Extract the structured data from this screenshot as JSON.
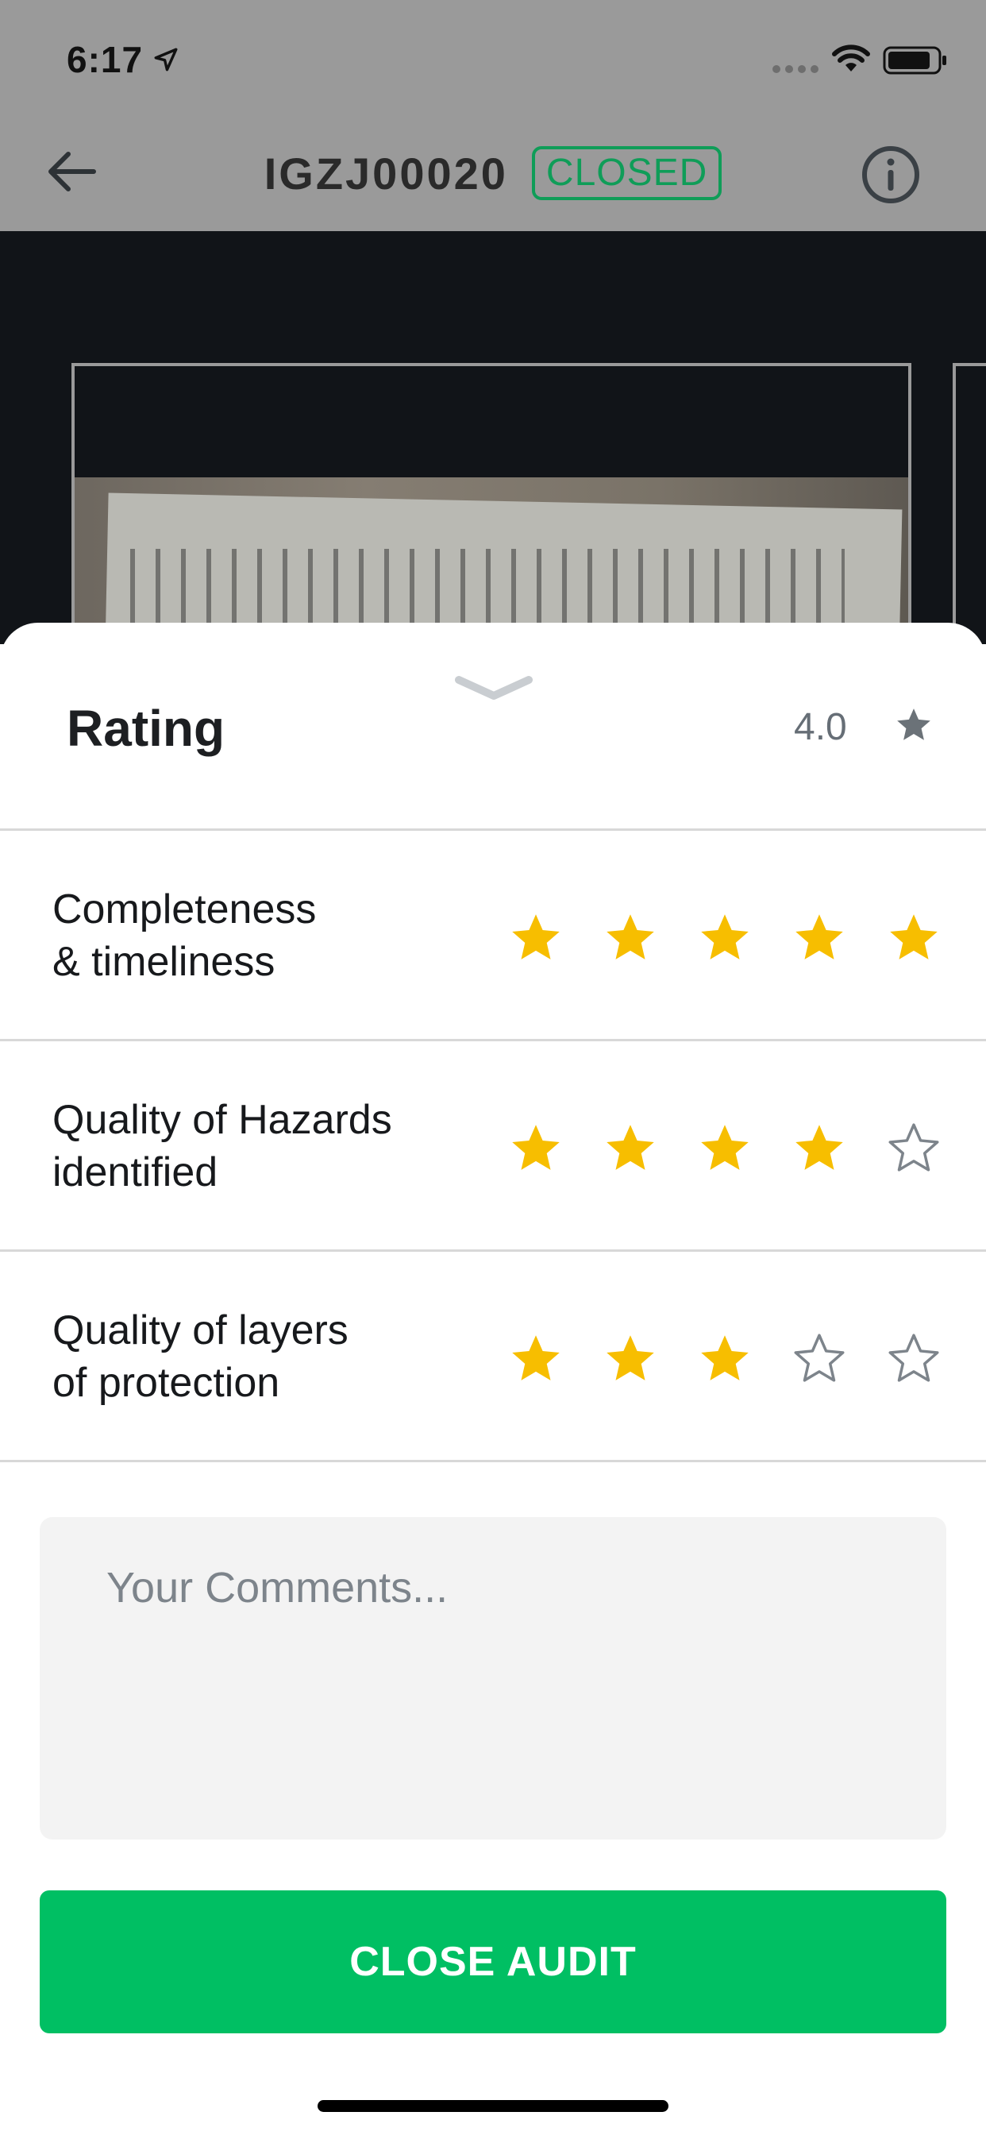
{
  "status_bar": {
    "time": "6:17",
    "icons": [
      "location-arrow-icon",
      "signal-icon",
      "wifi-icon",
      "battery-icon"
    ]
  },
  "header": {
    "back_icon": "arrow-left-icon",
    "title": "IGZJ00020",
    "status_badge": "CLOSED",
    "info_icon": "info-circle-icon"
  },
  "rating": {
    "title": "Rating",
    "value": "4.0",
    "icon": "star-icon",
    "criteria": [
      {
        "label": "Completeness\n& timeliness",
        "stars": 5,
        "max": 5
      },
      {
        "label": "Quality of Hazards\nidentified",
        "stars": 4,
        "max": 5
      },
      {
        "label": "Quality of layers\nof protection",
        "stars": 3,
        "max": 5
      }
    ]
  },
  "comments": {
    "placeholder": "Your Comments...",
    "value": ""
  },
  "actions": {
    "close_audit_label": "CLOSE AUDIT"
  },
  "colors": {
    "star_filled": "#F7BE00",
    "star_empty_stroke": "#7d848b",
    "accent_green": "#00BF63",
    "badge_green": "#0F9D58"
  }
}
